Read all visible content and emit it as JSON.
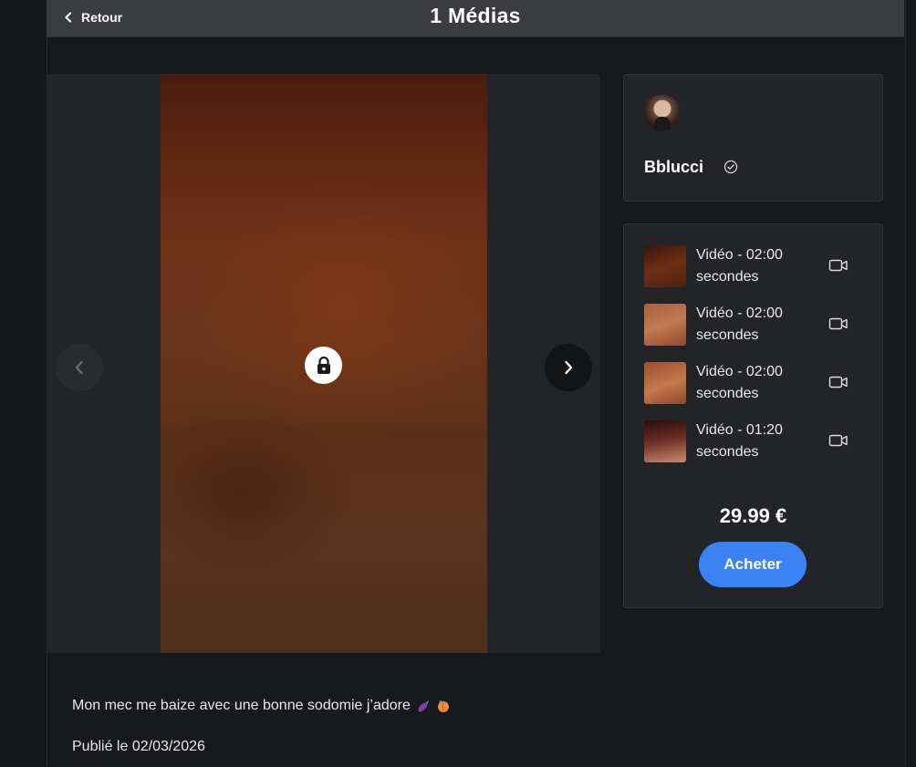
{
  "header": {
    "back_label": "Retour",
    "title": "1 Médias"
  },
  "viewer": {
    "locked_icon": "lock-icon",
    "prev_icon": "chevron-left-icon",
    "next_icon": "chevron-right-icon"
  },
  "profile": {
    "name": "Bblucci",
    "verified_icon": "verified-check-icon"
  },
  "media_items": [
    {
      "label": "Vidéo - 02:00 secondes",
      "icon": "video-camera-icon"
    },
    {
      "label": "Vidéo - 02:00 secondes",
      "icon": "video-camera-icon"
    },
    {
      "label": "Vidéo - 02:00 secondes",
      "icon": "video-camera-icon"
    },
    {
      "label": "Vidéo - 01:20 secondes",
      "icon": "video-camera-icon"
    }
  ],
  "purchase": {
    "price": "29.99 €",
    "buy_label": "Acheter"
  },
  "post": {
    "caption": "Mon mec me baize avec une bonne sodomie j’adore",
    "published": "Publié le 02/03/2026"
  },
  "colors": {
    "accent": "#3b82f6",
    "background": "#18191c",
    "card": "#232427",
    "topbar": "#3a3c3f"
  }
}
